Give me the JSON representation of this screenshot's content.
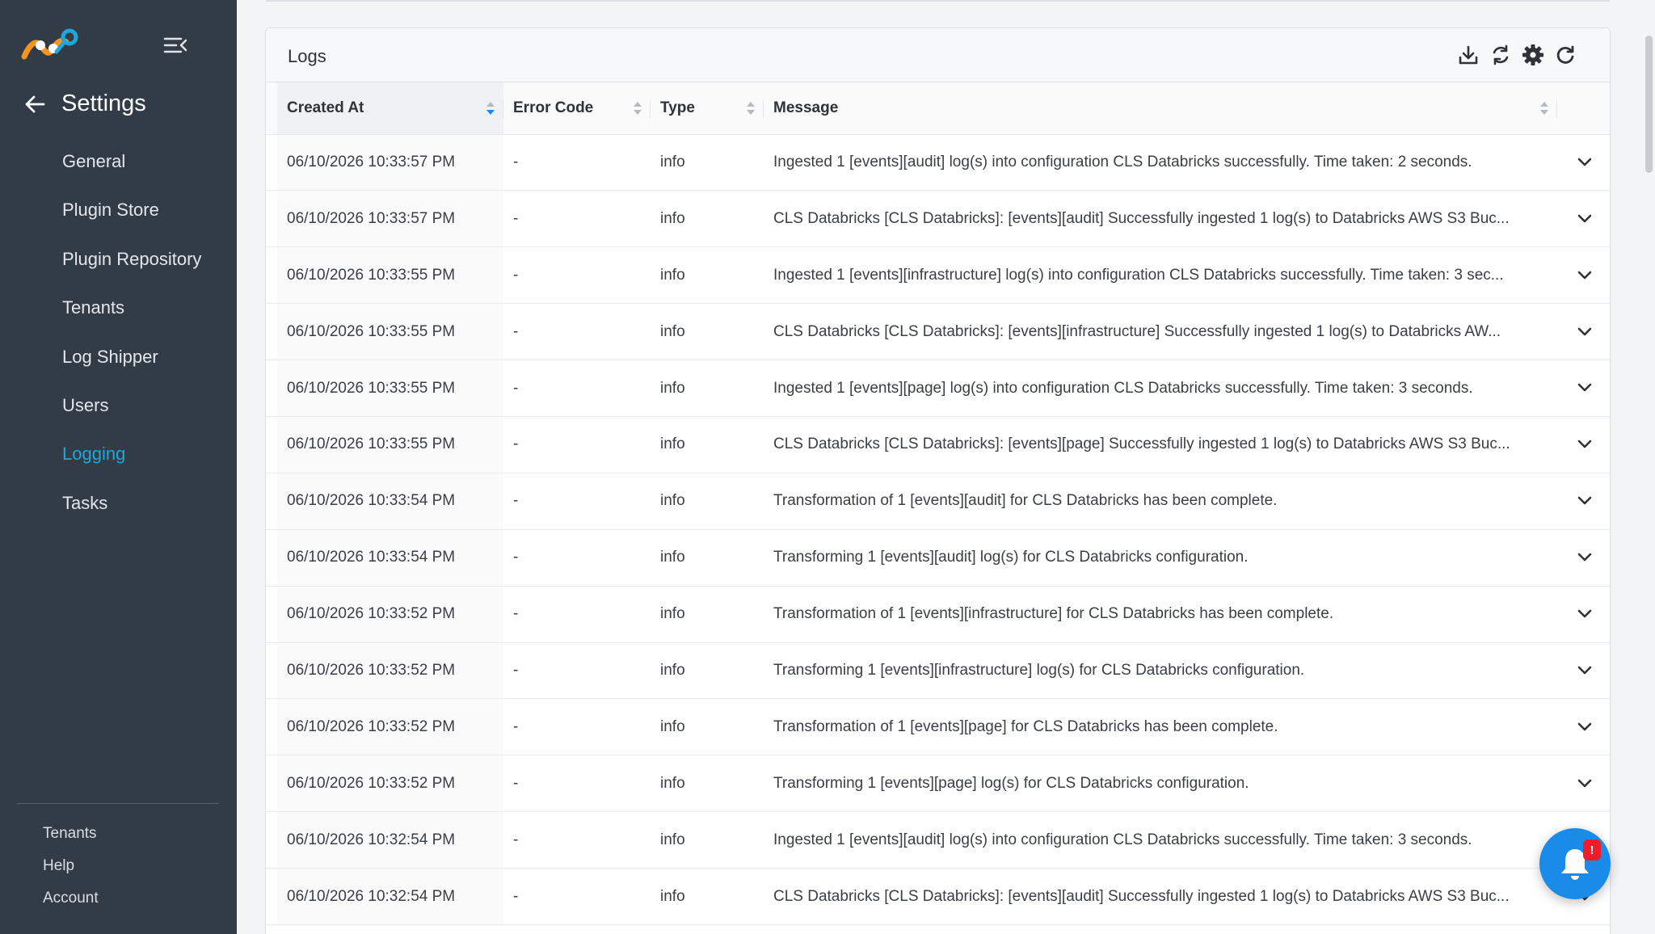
{
  "colors": {
    "sidebar_bg": "#323c47",
    "active_nav": "#1fa6dd",
    "bell_bg": "#1a8be8",
    "badge_bg": "#ef1c2b",
    "logo_orange": "#f7941d",
    "logo_blue": "#1fa6dd"
  },
  "sidebar": {
    "logo_icon": "netskope-logo-icon",
    "collapse_icon": "collapse-menu-icon",
    "back_icon": "arrow-left-icon",
    "title": "Settings",
    "items": [
      {
        "label": "General"
      },
      {
        "label": "Plugin Store"
      },
      {
        "label": "Plugin Repository"
      },
      {
        "label": "Tenants"
      },
      {
        "label": "Log Shipper"
      },
      {
        "label": "Users"
      },
      {
        "label": "Logging",
        "active": true
      },
      {
        "label": "Tasks"
      }
    ],
    "bottom": [
      {
        "label": "Tenants"
      },
      {
        "label": "Help"
      },
      {
        "label": "Account"
      }
    ]
  },
  "panel": {
    "title": "Logs",
    "tools": [
      "download-icon",
      "auto-refresh-icon",
      "settings-gear-icon",
      "refresh-icon"
    ]
  },
  "table": {
    "columns": [
      {
        "label": "Created At",
        "sorted": true
      },
      {
        "label": "Error Code"
      },
      {
        "label": "Type"
      },
      {
        "label": "Message"
      }
    ],
    "rows": [
      {
        "created": "06/10/2026 10:33:57 PM",
        "code": "-",
        "type": "info",
        "message": "Ingested 1 [events][audit] log(s) into configuration CLS Databricks successfully. Time taken: 2 seconds."
      },
      {
        "created": "06/10/2026 10:33:57 PM",
        "code": "-",
        "type": "info",
        "message": "CLS Databricks [CLS Databricks]: [events][audit] Successfully ingested 1 log(s) to Databricks AWS S3 Buc..."
      },
      {
        "created": "06/10/2026 10:33:55 PM",
        "code": "-",
        "type": "info",
        "message": "Ingested 1 [events][infrastructure] log(s) into configuration CLS Databricks successfully. Time taken: 3 sec..."
      },
      {
        "created": "06/10/2026 10:33:55 PM",
        "code": "-",
        "type": "info",
        "message": "CLS Databricks [CLS Databricks]: [events][infrastructure] Successfully ingested 1 log(s) to Databricks AW..."
      },
      {
        "created": "06/10/2026 10:33:55 PM",
        "code": "-",
        "type": "info",
        "message": "Ingested 1 [events][page] log(s) into configuration CLS Databricks successfully. Time taken: 3 seconds."
      },
      {
        "created": "06/10/2026 10:33:55 PM",
        "code": "-",
        "type": "info",
        "message": "CLS Databricks [CLS Databricks]: [events][page] Successfully ingested 1 log(s) to Databricks AWS S3 Buc..."
      },
      {
        "created": "06/10/2026 10:33:54 PM",
        "code": "-",
        "type": "info",
        "message": "Transformation of 1 [events][audit] for CLS Databricks has been complete."
      },
      {
        "created": "06/10/2026 10:33:54 PM",
        "code": "-",
        "type": "info",
        "message": "Transforming 1 [events][audit] log(s) for CLS Databricks configuration."
      },
      {
        "created": "06/10/2026 10:33:52 PM",
        "code": "-",
        "type": "info",
        "message": "Transformation of 1 [events][infrastructure] for CLS Databricks has been complete."
      },
      {
        "created": "06/10/2026 10:33:52 PM",
        "code": "-",
        "type": "info",
        "message": "Transforming 1 [events][infrastructure] log(s) for CLS Databricks configuration."
      },
      {
        "created": "06/10/2026 10:33:52 PM",
        "code": "-",
        "type": "info",
        "message": "Transformation of 1 [events][page] for CLS Databricks has been complete."
      },
      {
        "created": "06/10/2026 10:33:52 PM",
        "code": "-",
        "type": "info",
        "message": "Transforming 1 [events][page] log(s) for CLS Databricks configuration."
      },
      {
        "created": "06/10/2026 10:32:54 PM",
        "code": "-",
        "type": "info",
        "message": "Ingested 1 [events][audit] log(s) into configuration CLS Databricks successfully. Time taken: 3 seconds."
      },
      {
        "created": "06/10/2026 10:32:54 PM",
        "code": "-",
        "type": "info",
        "message": "CLS Databricks [CLS Databricks]: [events][audit] Successfully ingested 1 log(s) to Databricks AWS S3 Buc..."
      }
    ]
  },
  "notifications": {
    "icon": "bell-icon",
    "badge": "!"
  }
}
